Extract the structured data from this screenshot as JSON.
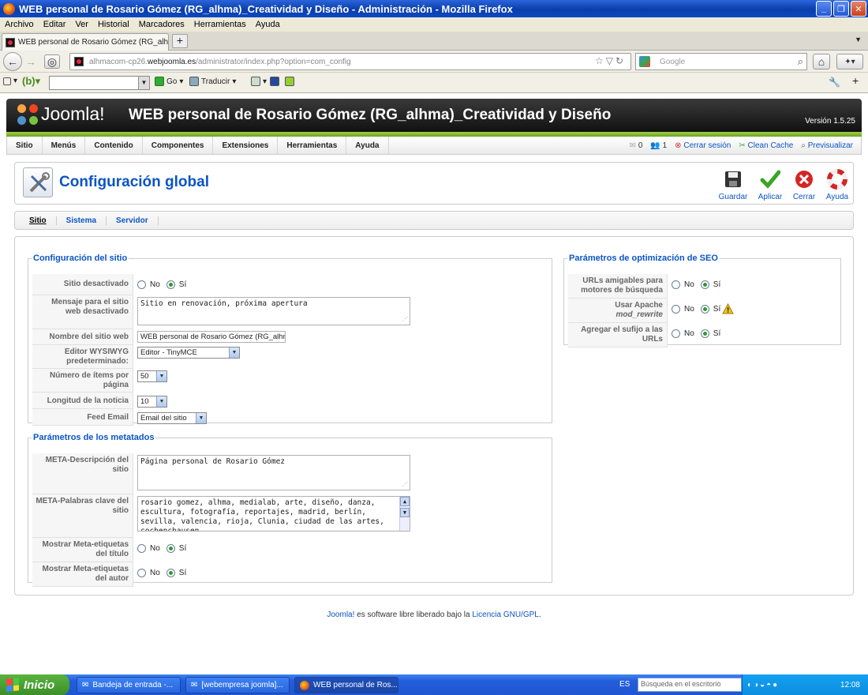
{
  "window": {
    "title": "WEB personal de Rosario Gómez (RG_alhma)_Creatividad y Diseño - Administración - Mozilla Firefox"
  },
  "browser_menu": [
    "Archivo",
    "Editar",
    "Ver",
    "Historial",
    "Marcadores",
    "Herramientas",
    "Ayuda"
  ],
  "tab": {
    "label": "WEB personal de Rosario Gómez (RG_alhma)..."
  },
  "address": {
    "prefix": "alhmacom-cp26.",
    "domain": "webjoomla.es",
    "path": "/administrator/index.php?option=com_config"
  },
  "search": {
    "placeholder": "Google"
  },
  "toolbar2": {
    "go": "Go",
    "translate": "Traducir"
  },
  "joomla": {
    "logo": "Joomla!",
    "site_name": "WEB personal de Rosario Gómez (RG_alhma)_Creatividad y Diseño",
    "version": "Versión 1.5.25"
  },
  "admin_menu": [
    "Sitio",
    "Menús",
    "Contenido",
    "Componentes",
    "Extensiones",
    "Herramientas",
    "Ayuda"
  ],
  "status": {
    "messages": "0",
    "users": "1",
    "logout": "Cerrar sesión",
    "clean_cache": "Clean Cache",
    "preview": "Previsualizar"
  },
  "page_title": "Configuración global",
  "actions": {
    "save": "Guardar",
    "apply": "Aplicar",
    "close": "Cerrar",
    "help": "Ayuda"
  },
  "subtabs": [
    "Sitio",
    "Sistema",
    "Servidor"
  ],
  "site_config": {
    "legend": "Configuración del sitio",
    "offline_label": "Sitio desactivado",
    "offline_message_label": "Mensaje para el sitio web desactivado",
    "offline_message": "Sitio en renovación, próxima apertura",
    "sitename_label": "Nombre del sitio web",
    "sitename": "WEB personal de Rosario Gómez (RG_alhma)",
    "editor_label": "Editor WYSIWYG predeterminado:",
    "editor": "Editor - TinyMCE",
    "list_limit_label": "Número de ítems por página",
    "list_limit": "50",
    "feed_limit_label": "Longitud de la noticia",
    "feed_limit": "10",
    "feed_email_label": "Feed Email",
    "feed_email": "Email del sitio"
  },
  "radio": {
    "no": "No",
    "yes": "Sí"
  },
  "metadata": {
    "legend": "Parámetros de los metatados",
    "desc_label": "META-Descripción del sitio",
    "desc": "Página personal de Rosario Gómez",
    "keys_label": "META-Palabras clave del sitio",
    "keys": "rosario gomez, alhma, medialab, arte, diseño, danza, escultura, fotografía, reportajes, madrid, berlín, sevilla, valencia, rioja, Clunia, ciudad de las artes, cochenchausen",
    "show_title_label": "Mostrar Meta-etiquetas del título",
    "show_author_label": "Mostrar Meta-etiquetas del autor"
  },
  "seo": {
    "legend": "Parámetros de optimización de SEO",
    "sef_label": "URLs amigables para motores de búsqueda",
    "rewrite_label": "Usar Apache",
    "rewrite_sub": "mod_rewrite",
    "suffix_label": "Agregar el sufijo a las URLs"
  },
  "footer": {
    "joomla": "Joomla!",
    "text": " es software libre liberado bajo la ",
    "license": "Licencia GNU/GPL",
    "end": "."
  },
  "taskbar": {
    "start": "Inicio",
    "tasks": [
      "Bandeja de entrada -...",
      "[webempresa joomla]...",
      "WEB personal de Ros..."
    ],
    "lang": "ES",
    "search": "Búsqueda en el escritorio",
    "clock": "12:08"
  }
}
